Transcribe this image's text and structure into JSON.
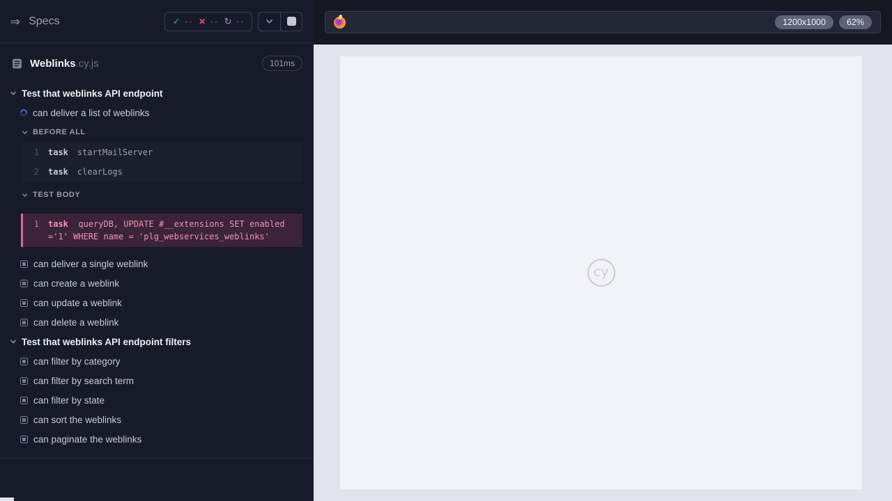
{
  "header": {
    "specs_label": "Specs",
    "stats": {
      "passed": "--",
      "failed": "--",
      "pending": "--"
    }
  },
  "spec": {
    "name": "Weblinks",
    "extension": ".cy.js",
    "duration": "101ms"
  },
  "suite1": {
    "title": "Test that weblinks API endpoint",
    "running_test": "can deliver a list of weblinks",
    "before_all": {
      "label": "BEFORE ALL",
      "commands": [
        {
          "n": "1",
          "method": "task",
          "message": "startMailServer"
        },
        {
          "n": "2",
          "method": "task",
          "message": "clearLogs"
        }
      ]
    },
    "test_body": {
      "label": "TEST BODY",
      "commands": [
        {
          "n": "1",
          "method": "task",
          "message": "queryDB, UPDATE #__extensions SET enabled ='1' WHERE name = 'plg_webservices_weblinks'"
        }
      ]
    },
    "tests": [
      "can deliver a single weblink",
      "can create a weblink",
      "can update a weblink",
      "can delete a weblink"
    ]
  },
  "suite2": {
    "title": "Test that weblinks API endpoint filters",
    "tests": [
      "can filter by category",
      "can filter by search term",
      "can filter by state",
      "can sort the weblinks",
      "can paginate the weblinks"
    ]
  },
  "browser": {
    "url_value": "",
    "viewport_size": "1200x1000",
    "zoom_level": "62%",
    "logo_text": "cy"
  }
}
